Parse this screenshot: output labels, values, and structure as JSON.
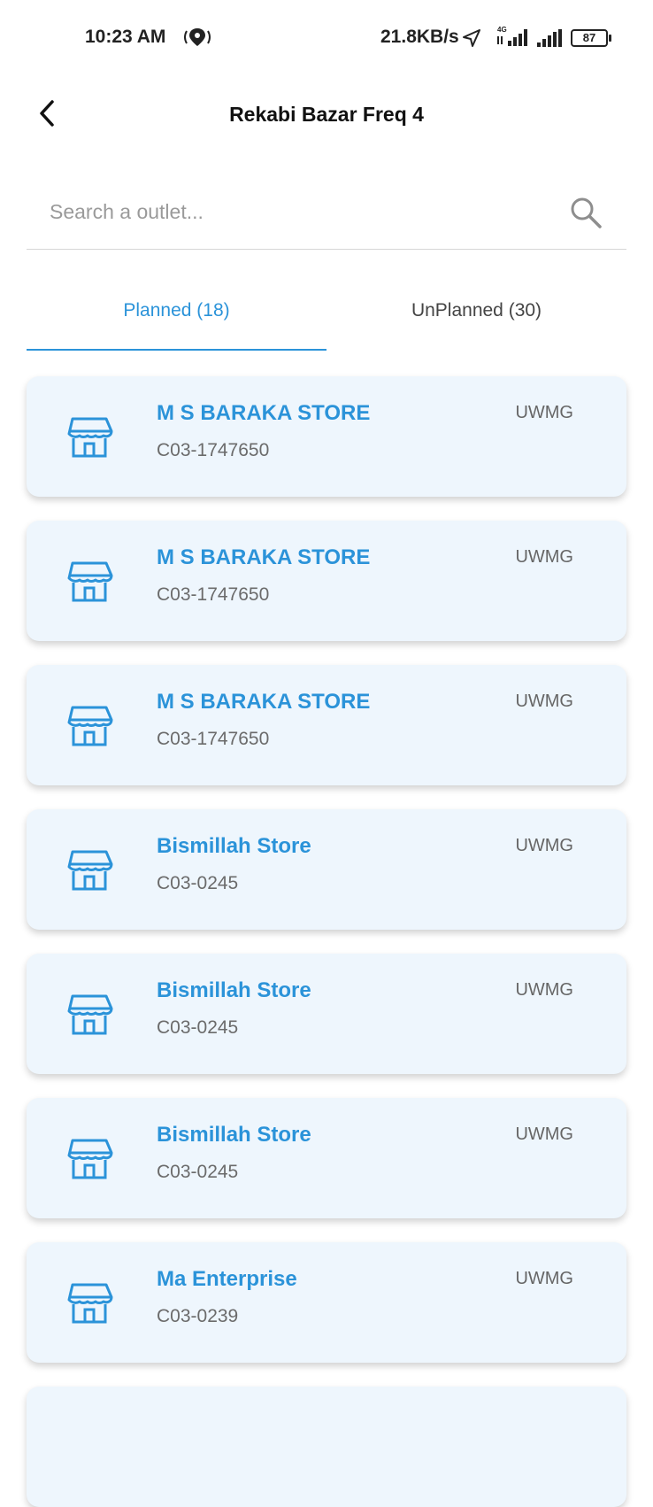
{
  "status_bar": {
    "time": "10:23 AM",
    "speed": "21.8KB/s",
    "network": "4G",
    "battery": "87",
    "icons": [
      "location-pin-icon",
      "navigation-arrow-icon",
      "signal-icon",
      "battery-icon"
    ]
  },
  "header": {
    "title": "Rekabi Bazar Freq 4",
    "back_icon": "back-chevron-icon"
  },
  "search": {
    "placeholder": "Search a outlet...",
    "value": "",
    "icon": "search-icon"
  },
  "tabs": [
    {
      "label": "Planned (18)",
      "active": true
    },
    {
      "label": "UnPlanned (30)",
      "active": false
    }
  ],
  "outlets": [
    {
      "name": "M S BARAKA STORE",
      "code": "C03-1747650",
      "tag": "UWMG",
      "icon": "store-icon"
    },
    {
      "name": "M S BARAKA STORE",
      "code": "C03-1747650",
      "tag": "UWMG",
      "icon": "store-icon"
    },
    {
      "name": "M S BARAKA STORE",
      "code": "C03-1747650",
      "tag": "UWMG",
      "icon": "store-icon"
    },
    {
      "name": "Bismillah Store",
      "code": "C03-0245",
      "tag": "UWMG",
      "icon": "store-icon"
    },
    {
      "name": "Bismillah Store",
      "code": "C03-0245",
      "tag": "UWMG",
      "icon": "store-icon"
    },
    {
      "name": "Bismillah Store",
      "code": "C03-0245",
      "tag": "UWMG",
      "icon": "store-icon"
    },
    {
      "name": "Ma Enterprise",
      "code": "C03-0239",
      "tag": "UWMG",
      "icon": "store-icon"
    },
    {
      "name": "",
      "code": "",
      "tag": "",
      "icon": "store-icon"
    }
  ],
  "colors": {
    "accent": "#2b93d9",
    "card_bg": "#eef6fd",
    "muted_text": "#6b6b6b"
  }
}
